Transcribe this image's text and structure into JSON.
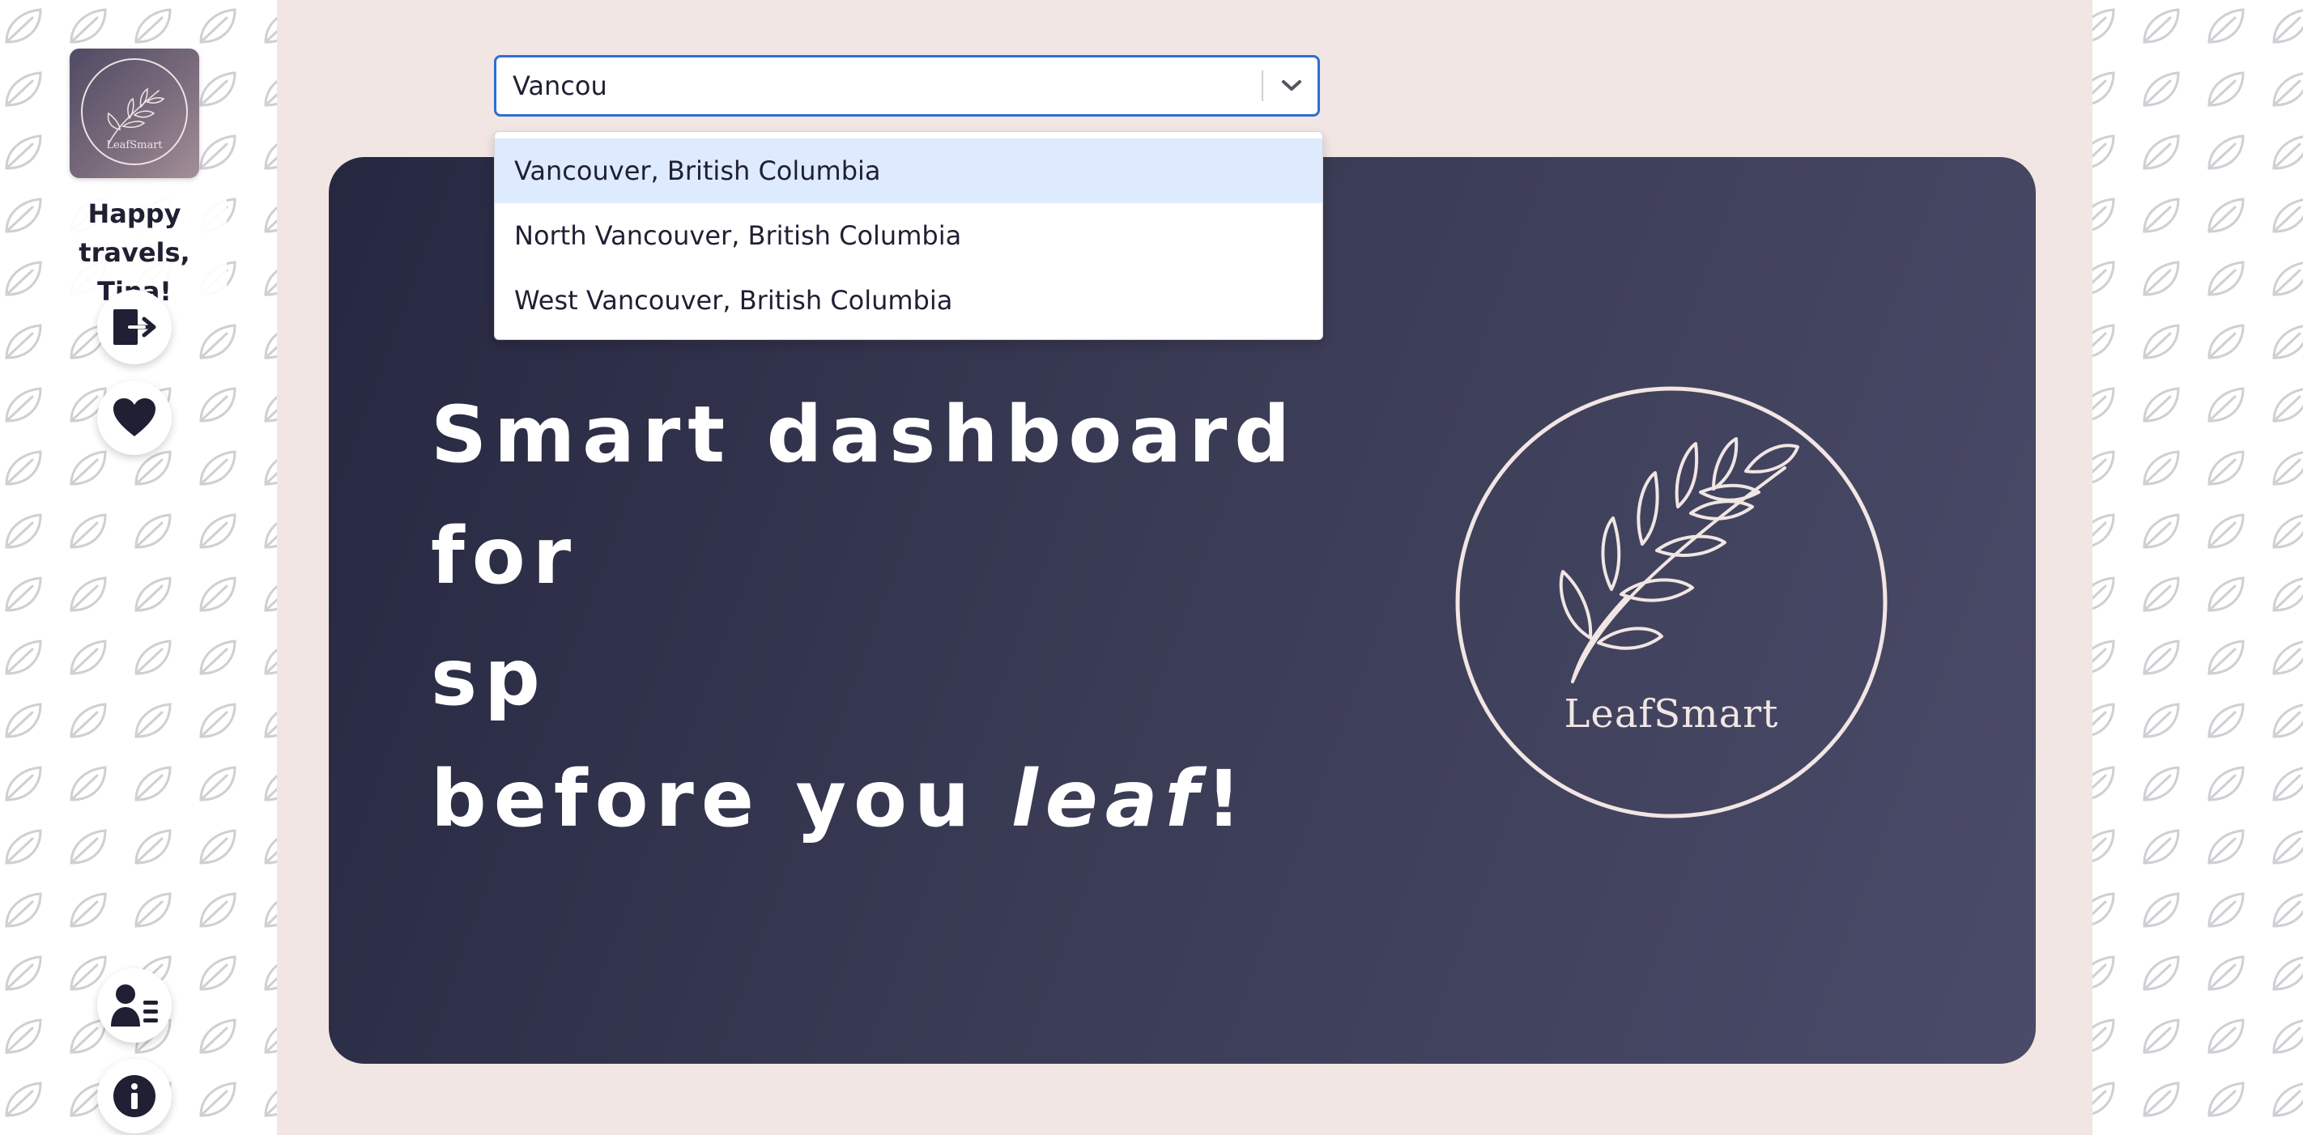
{
  "sidebar": {
    "logo_icon": "leafsmart-logo",
    "logo_text": "LeafSmart",
    "greeting_line1": "Happy",
    "greeting_line2": "travels, Tina!",
    "buttons": [
      {
        "icon": "logout-icon"
      },
      {
        "icon": "heart-icon"
      },
      {
        "icon": "user-list-icon"
      },
      {
        "icon": "info-icon"
      }
    ]
  },
  "search": {
    "value": "Vancou",
    "toggle_icon": "chevron-down-icon",
    "options": [
      {
        "label": "Vancouver, British Columbia",
        "highlighted": true
      },
      {
        "label": "North Vancouver, British Columbia",
        "highlighted": false
      },
      {
        "label": "West Vancouver, British Columbia",
        "highlighted": false
      }
    ]
  },
  "hero": {
    "line1": "Smart dashboard",
    "line2": "for",
    "line3": "sp",
    "line4_prefix": "before you ",
    "line4_emphasis": "leaf",
    "line4_suffix": "!",
    "logo_text": "LeafSmart"
  },
  "colors": {
    "accent_blue": "#2f6fd6",
    "panel_bg": "#f1e6e3",
    "hero_dark": "#262740",
    "icon_dark": "#1f2033",
    "highlight": "#deebff"
  }
}
